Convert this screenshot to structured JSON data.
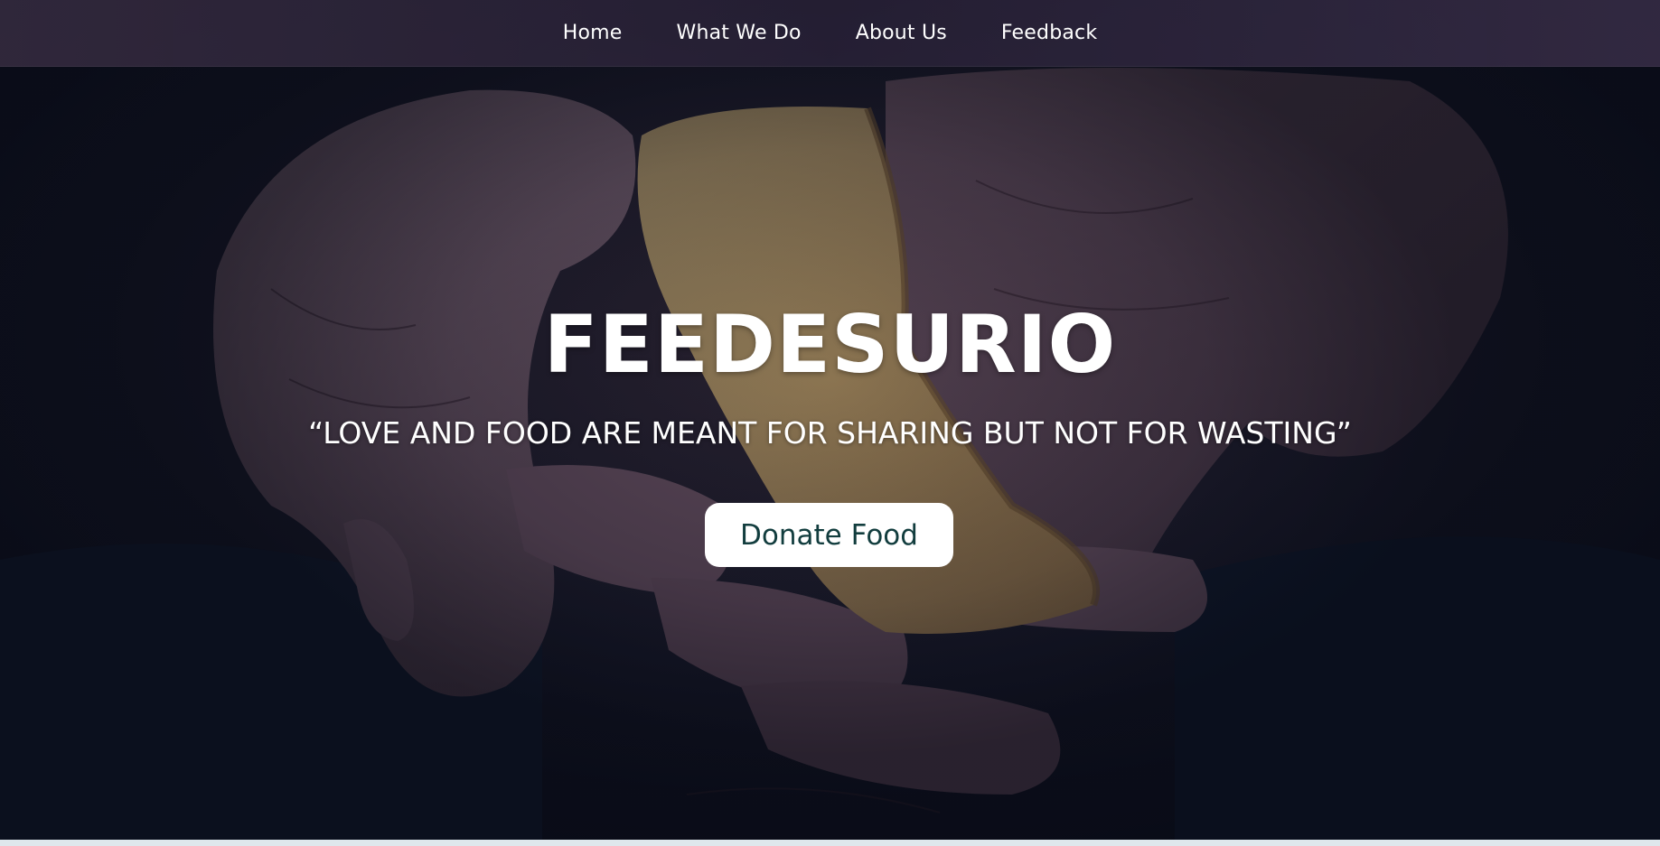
{
  "nav": {
    "items": [
      {
        "label": "Home"
      },
      {
        "label": "What We Do"
      },
      {
        "label": "About Us"
      },
      {
        "label": "Feedback"
      }
    ]
  },
  "hero": {
    "title": "FEEDESURIO",
    "tagline": "“LOVE AND FOOD ARE MEANT FOR SHARING BUT NOT FOR WASTING”",
    "cta_label": "Donate Food",
    "background_image": "hands-holding-bread-photo"
  },
  "colors": {
    "nav_bg": "#3d3046",
    "cta_bg": "#ffffff",
    "cta_text": "#123d3e",
    "text": "#ffffff"
  }
}
